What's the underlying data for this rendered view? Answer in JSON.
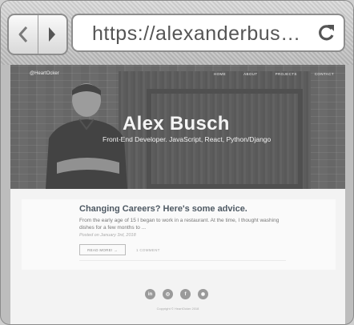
{
  "browser": {
    "url": "https://alexanderbusc…",
    "back_icon": "chevron-left-icon",
    "forward_icon": "chevron-right-icon",
    "reload_icon": "reload-icon"
  },
  "site": {
    "brand": "@HeartOcker",
    "nav": [
      "HOME",
      "ABOUT",
      "PROJECTS",
      "CONTACT"
    ]
  },
  "hero": {
    "name": "Alex Busch",
    "subtitle": "Front-End Developer. JavaScript, React, Python/Django"
  },
  "post": {
    "title": "Changing Careers? Here's some advice.",
    "excerpt": "From the early age of 15 I began to work in a restaurant. At the time, I thought washing dishes for a few months to ...",
    "date": "Posted on January 3rd, 2018",
    "read_more": "READ MORE! →",
    "comments": "1 COMMENT"
  },
  "footer": {
    "socials": [
      {
        "icon": "linkedin-icon",
        "glyph": "in"
      },
      {
        "icon": "instagram-icon",
        "glyph": "◎"
      },
      {
        "icon": "facebook-icon",
        "glyph": "f"
      },
      {
        "icon": "github-icon",
        "glyph": "◉"
      }
    ],
    "copyright": "Copyright © HeartOcker 2018"
  }
}
